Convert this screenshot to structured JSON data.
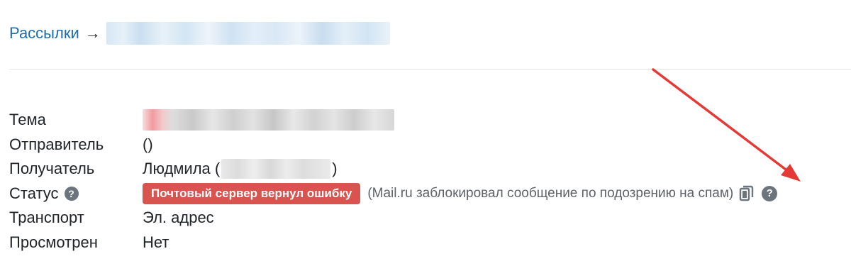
{
  "breadcrumb": {
    "root_label": "Рассылки",
    "arrow": "→"
  },
  "details": {
    "subject": {
      "label": "Тема"
    },
    "sender": {
      "label": "Отправитель",
      "value": "()"
    },
    "recipient": {
      "label": "Получатель",
      "name": "Людмила (",
      "close": ")"
    },
    "status": {
      "label": "Статус",
      "help": "?",
      "badge": "Почтовый сервер вернул ошибку",
      "badge_color": "#d9534f",
      "detail": "(Mail.ru заблокировал сообщение по подозрению на спам)",
      "help2": "?"
    },
    "transport": {
      "label": "Транспорт",
      "value": "Эл. адрес"
    },
    "viewed": {
      "label": "Просмотрен",
      "value": "Нет"
    }
  },
  "icons": {
    "copy": "copy-icon",
    "help": "question-circle-icon"
  },
  "annotation_color": "#e53935"
}
